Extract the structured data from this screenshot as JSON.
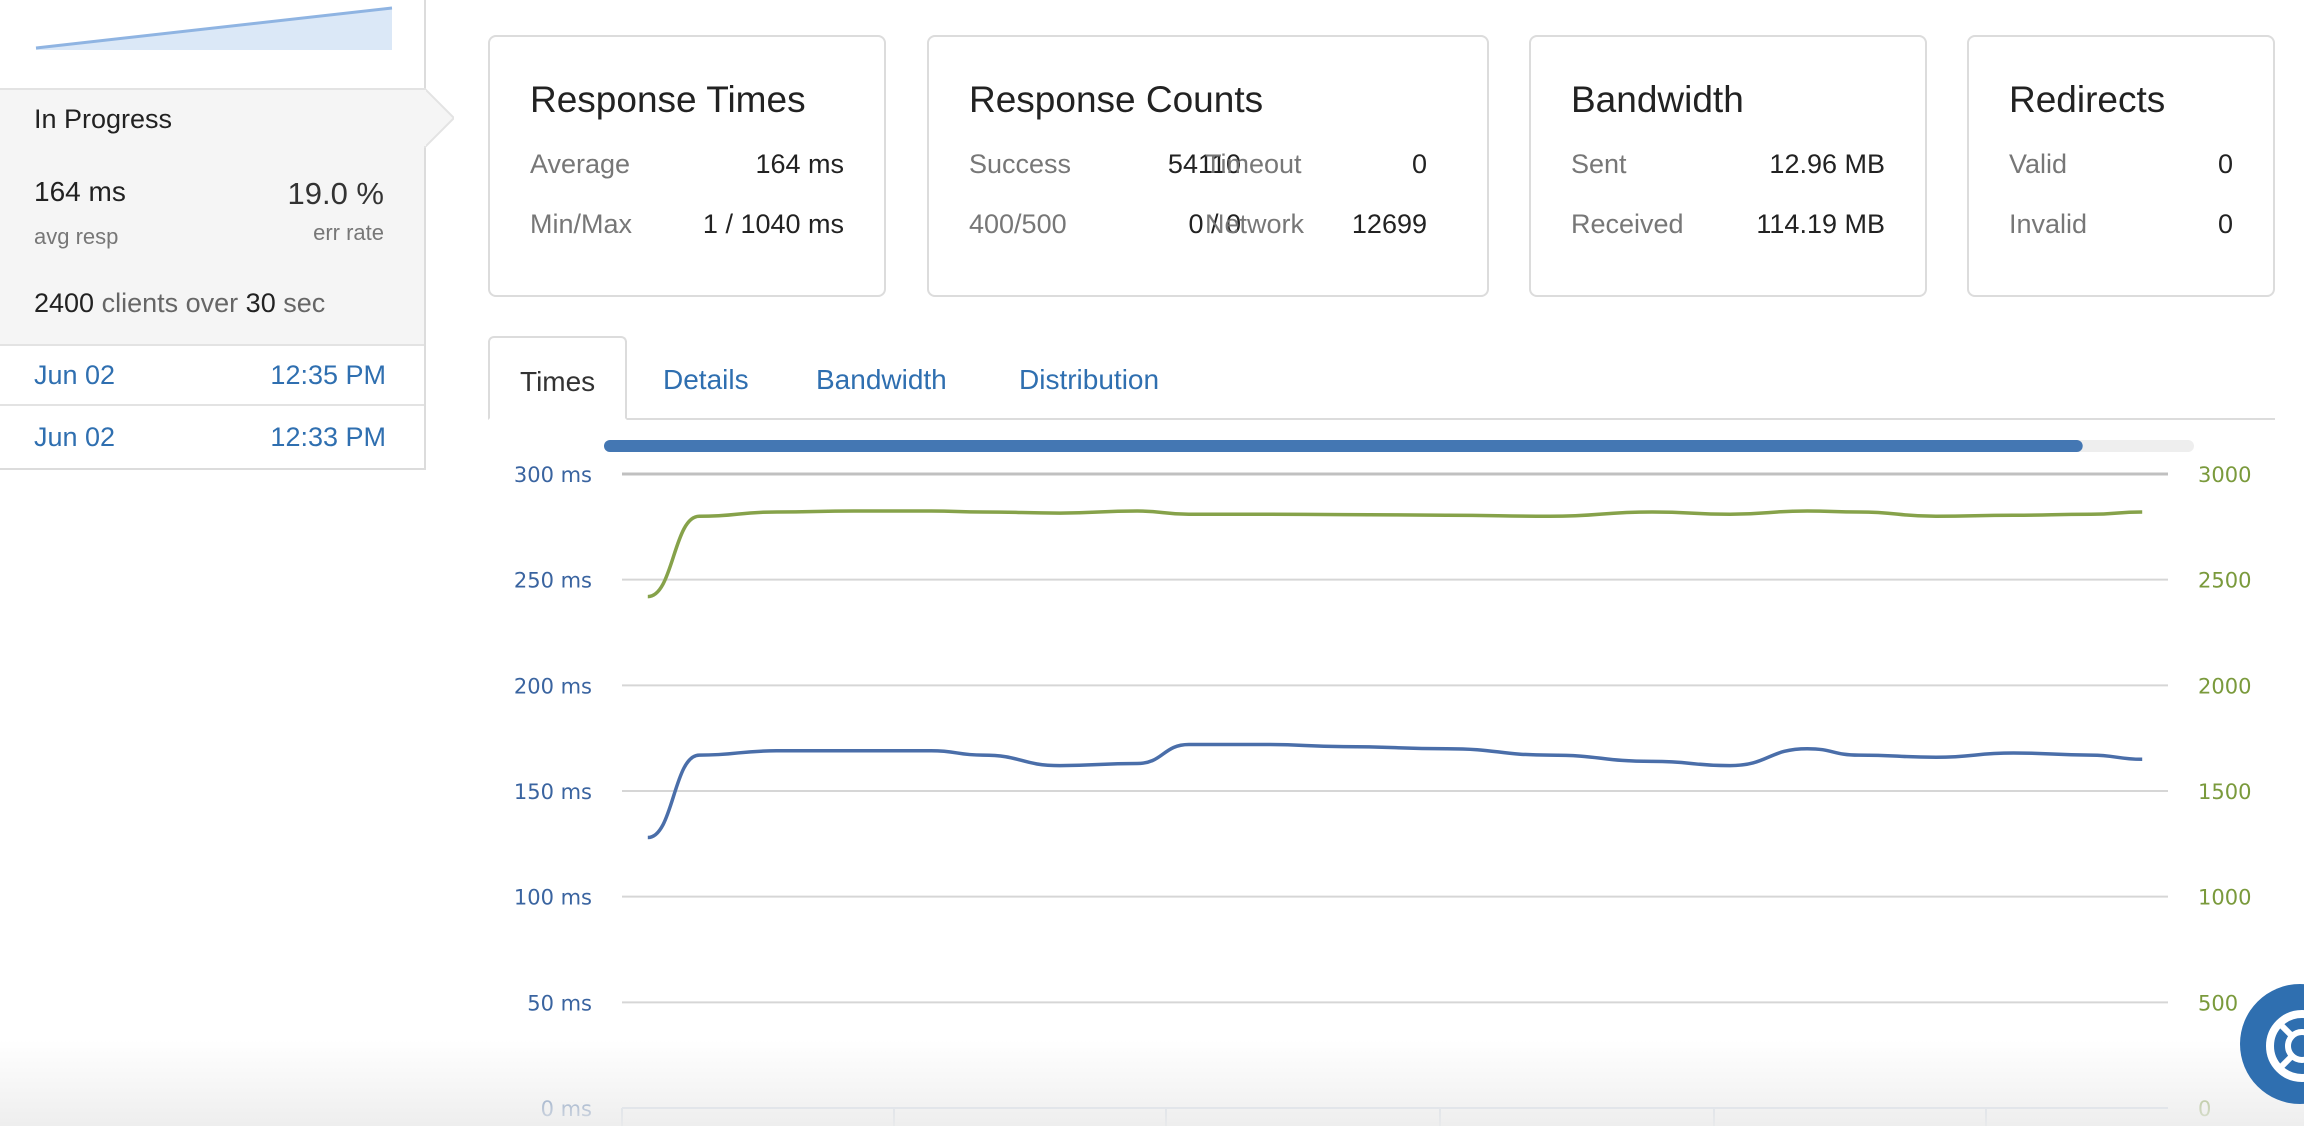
{
  "sidebar": {
    "status_title": "In Progress",
    "avg_resp_value": "164 ms",
    "avg_resp_label": "avg resp",
    "err_rate_value": "19.0 %",
    "err_rate_label": "err rate",
    "clients_count": "2400",
    "clients_text": "clients over",
    "duration_value": "30",
    "duration_unit": "sec",
    "runs": [
      {
        "date": "Jun 02",
        "time": "12:35 PM"
      },
      {
        "date": "Jun 02",
        "time": "12:33 PM"
      }
    ]
  },
  "cards": {
    "response_times": {
      "title": "Response Times",
      "average_label": "Average",
      "average_value": "164 ms",
      "minmax_label": "Min/Max",
      "minmax_value": "1 / 1040 ms"
    },
    "response_counts": {
      "title": "Response Counts",
      "success_label": "Success",
      "success_value": "54110",
      "timeout_label": "Timeout",
      "timeout_value": "0",
      "errors_label": "400/500",
      "errors_value": "0 / 0",
      "network_label": "Network",
      "network_value": "12699"
    },
    "bandwidth": {
      "title": "Bandwidth",
      "sent_label": "Sent",
      "sent_value": "12.96 MB",
      "received_label": "Received",
      "received_value": "114.19 MB"
    },
    "redirects": {
      "title": "Redirects",
      "valid_label": "Valid",
      "valid_value": "0",
      "invalid_label": "Invalid",
      "invalid_value": "0"
    }
  },
  "tabs": [
    {
      "label": "Times",
      "active": true
    },
    {
      "label": "Details",
      "active": false
    },
    {
      "label": "Bandwidth",
      "active": false
    },
    {
      "label": "Distribution",
      "active": false
    }
  ],
  "progress": {
    "fraction": 0.93
  },
  "colors": {
    "accent": "#2f6fb0",
    "response_line": "#4a6ea9",
    "clients_line": "#86a24a",
    "progress": "#4477b3"
  },
  "chart_data": {
    "type": "line",
    "y_left": {
      "ticks": [
        "300 ms",
        "250 ms",
        "200 ms",
        "150 ms",
        "100 ms",
        "50 ms",
        "0 ms"
      ],
      "ylim": [
        0,
        300
      ]
    },
    "y_right": {
      "ticks": [
        "3000",
        "2500",
        "2000",
        "1500",
        "1000",
        "500",
        "0"
      ],
      "ylim": [
        0,
        3000
      ]
    },
    "x": [
      0.5,
      1.5,
      3,
      4.5,
      6,
      7,
      8.5,
      10,
      11,
      12.5,
      14,
      16,
      18,
      20,
      21.5,
      23,
      24,
      25.5,
      27,
      28.5,
      29.5
    ],
    "series": [
      {
        "axis": "left",
        "values": [
          128,
          167,
          169,
          169,
          169,
          167,
          162,
          163,
          172,
          172,
          171,
          170,
          167,
          164,
          162,
          170,
          167,
          166,
          168,
          167,
          165
        ]
      },
      {
        "axis": "right",
        "values": [
          2420,
          2800,
          2820,
          2825,
          2825,
          2820,
          2815,
          2825,
          2810,
          2810,
          2808,
          2805,
          2800,
          2820,
          2810,
          2825,
          2820,
          2800,
          2805,
          2810,
          2820
        ]
      }
    ],
    "grid": true
  }
}
